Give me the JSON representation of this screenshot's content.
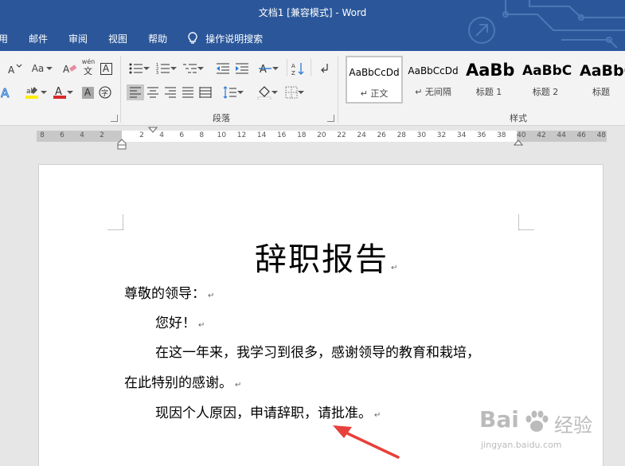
{
  "window": {
    "title": "文档1 [兼容模式]  -  Word"
  },
  "menu": {
    "items": [
      "用",
      "邮件",
      "审阅",
      "视图",
      "帮助"
    ],
    "tellme": "操作说明搜索"
  },
  "ribbon": {
    "font_group": {
      "aa_label": "Aa",
      "wen_label": "wén",
      "char_a": "A"
    },
    "paragraph_label": "段落",
    "styles_label": "样式",
    "styles": [
      {
        "sample": "AaBbCcDd",
        "name": "↵ 正文"
      },
      {
        "sample": "AaBbCcDd",
        "name": "↵ 无间隔"
      },
      {
        "sample": "AaBb",
        "name": "标题 1"
      },
      {
        "sample": "AaBbC",
        "name": "标题 2"
      },
      {
        "sample": "AaBbC",
        "name": "标题"
      }
    ]
  },
  "ruler": {
    "ticks": [
      "8",
      "6",
      "4",
      "2",
      "2",
      "4",
      "6",
      "8",
      "10",
      "12",
      "14",
      "16",
      "18",
      "20",
      "22",
      "24",
      "26",
      "28",
      "30",
      "32",
      "34",
      "36",
      "38",
      "40",
      "42",
      "44",
      "46",
      "48"
    ]
  },
  "document": {
    "title": "辞职报告",
    "mark": "↵",
    "lines": [
      "尊敬的领导：",
      "您好！",
      "在这一年来，我学习到很多，感谢领导的教育和栽培，",
      "在此特别的感谢。",
      "现因个人原因，申请辞职，请批准。"
    ]
  },
  "watermark": {
    "brand": "Bai",
    "brand2": "经验",
    "url": "jingyan.baidu.com"
  },
  "colors": {
    "ribbon_blue": "#2b579a",
    "arrow_red": "#e8403a",
    "underline_yellow": "#ffee00",
    "font_red": "#d62b2b"
  }
}
